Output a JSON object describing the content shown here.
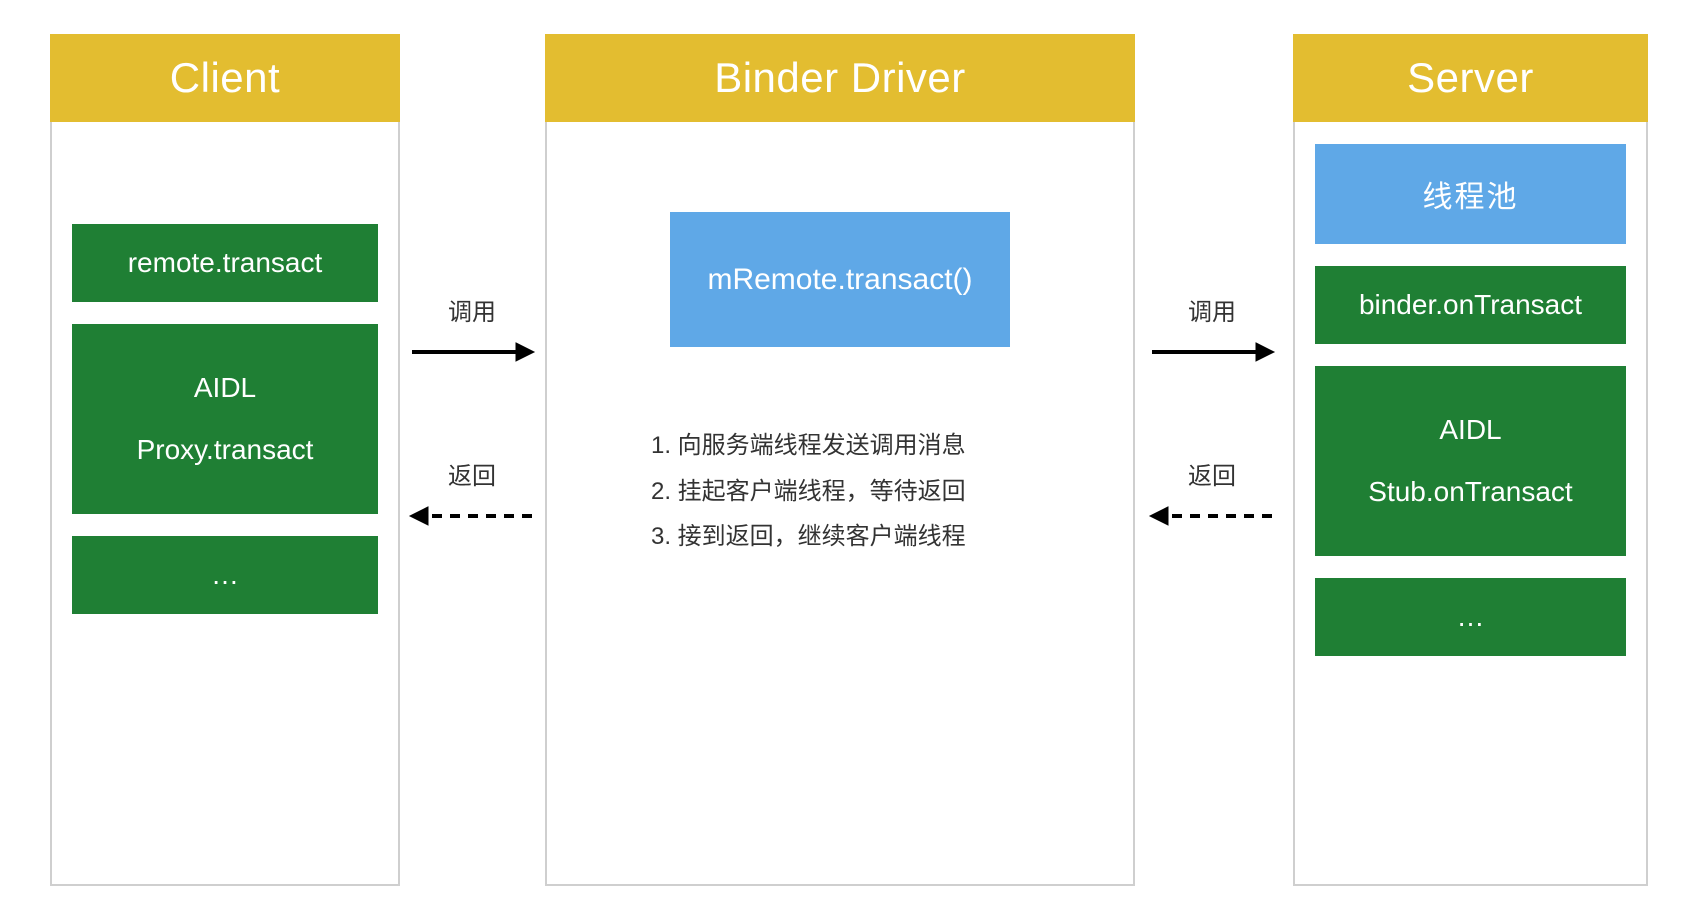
{
  "colors": {
    "gold": "#e3bd30",
    "green": "#1f7f34",
    "blue": "#5fa8e7",
    "border": "#cfcfcf"
  },
  "client": {
    "title": "Client",
    "box1": "remote.transact",
    "aidl_line1": "AIDL",
    "aidl_line2": "Proxy.transact",
    "more": "…"
  },
  "driver": {
    "title": "Binder Driver",
    "transact": "mRemote.transact()",
    "step1": "1.  向服务端线程发送调用消息",
    "step2": "2.  挂起客户端线程，等待返回",
    "step3": "3.  接到返回，继续客户端线程"
  },
  "server": {
    "title": "Server",
    "threadpool": "线程池",
    "onTransact": "binder.onTransact",
    "aidl_line1": "AIDL",
    "aidl_line2": "Stub.onTransact",
    "more": "…"
  },
  "arrows": {
    "call": "调用",
    "ret": "返回"
  }
}
